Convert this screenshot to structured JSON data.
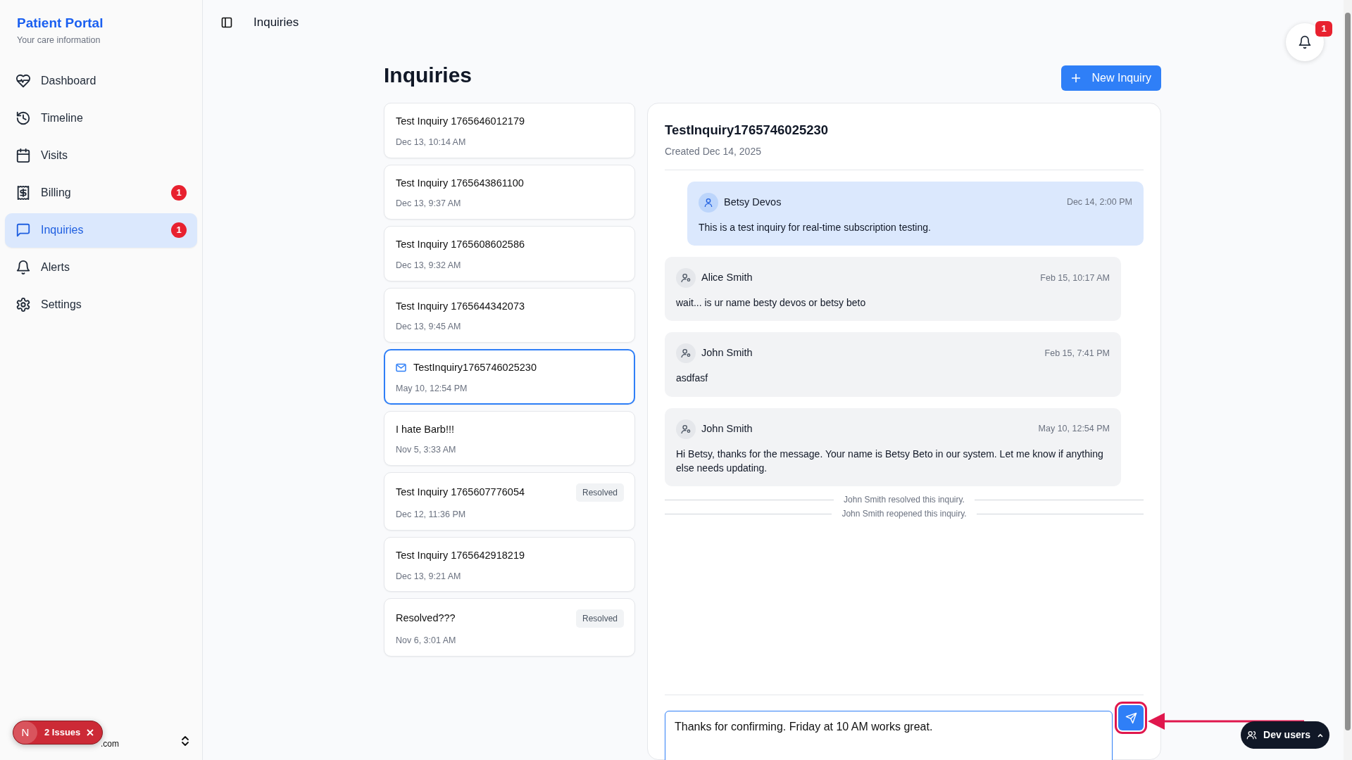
{
  "sidebar": {
    "brand": "Patient Portal",
    "tagline": "Your care information",
    "items": [
      {
        "label": "Dashboard",
        "selected": false
      },
      {
        "label": "Timeline",
        "selected": false
      },
      {
        "label": "Visits",
        "selected": false
      },
      {
        "label": "Billing",
        "selected": false,
        "badge": "1"
      },
      {
        "label": "Inquiries",
        "selected": true,
        "badge": "1"
      },
      {
        "label": "Alerts",
        "selected": false
      },
      {
        "label": "Settings",
        "selected": false
      }
    ],
    "user_email": ".com"
  },
  "issues_badge": {
    "initial": "N",
    "label": "2 Issues"
  },
  "header": {
    "title": "Inquiries",
    "notification_count": "1"
  },
  "page": {
    "title": "Inquiries",
    "new_button": "New Inquiry"
  },
  "inquiries": [
    {
      "title": "Test Inquiry 1765646012179",
      "date": "Dec 13, 10:14 AM",
      "selected": false,
      "unread": false
    },
    {
      "title": "Test Inquiry 1765643861100",
      "date": "Dec 13, 9:37 AM",
      "selected": false,
      "unread": false
    },
    {
      "title": "Test Inquiry 1765608602586",
      "date": "Dec 13, 9:32 AM",
      "selected": false,
      "unread": false
    },
    {
      "title": "Test Inquiry 1765644342073",
      "date": "Dec 13, 9:45 AM",
      "selected": false,
      "unread": false
    },
    {
      "title": "TestInquiry1765746025230",
      "date": "May 10, 12:54 PM",
      "selected": true,
      "unread": true
    },
    {
      "title": "I hate Barb!!!",
      "date": "Nov 5, 3:33 AM",
      "selected": false,
      "unread": false
    },
    {
      "title": "Test Inquiry 1765607776054",
      "date": "Dec 12, 11:36 PM",
      "selected": false,
      "unread": false,
      "status": "Resolved"
    },
    {
      "title": "Test Inquiry 1765642918219",
      "date": "Dec 13, 9:21 AM",
      "selected": false,
      "unread": false
    },
    {
      "title": "Resolved???",
      "date": "Nov 6, 3:01 AM",
      "selected": false,
      "unread": false,
      "status": "Resolved"
    }
  ],
  "detail": {
    "title": "TestInquiry1765746025230",
    "created": "Created Dec 14, 2025",
    "messages": [
      {
        "kind": "patient",
        "author": "Betsy Devos",
        "time": "Dec 14, 2:00 PM",
        "text": "This is a test inquiry for real-time subscription testing."
      },
      {
        "kind": "staff",
        "author": "Alice Smith",
        "time": "Feb 15, 10:17 AM",
        "text": "wait... is ur name besty devos or betsy beto"
      },
      {
        "kind": "staff",
        "author": "John Smith",
        "time": "Feb 15, 7:41 PM",
        "text": "asdfasf"
      },
      {
        "kind": "staff",
        "author": "John Smith",
        "time": "May 10, 12:54 PM",
        "text": "Hi Betsy, thanks for the message. Your name is Betsy Beto in our system. Let me know if anything else needs updating."
      },
      {
        "kind": "event",
        "text": "John Smith resolved this inquiry."
      },
      {
        "kind": "event",
        "text": "John Smith reopened this inquiry."
      }
    ],
    "reply": "Thanks for confirming. Friday at 10 AM works great."
  },
  "dev_users": {
    "label": "Dev users"
  }
}
